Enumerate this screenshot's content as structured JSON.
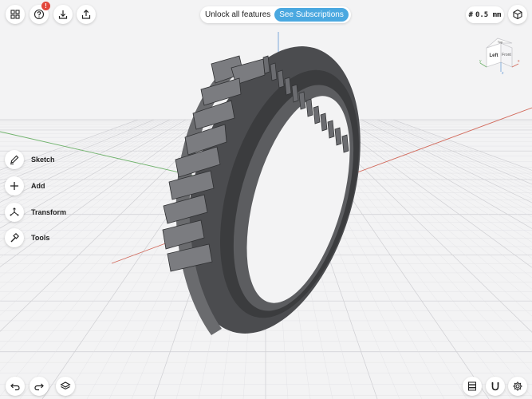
{
  "topbar": {
    "subscription_text": "Unlock all features",
    "subscription_button": "See Subscriptions",
    "grid_size": "0.5 mm",
    "help_badge": "!"
  },
  "view_cube": {
    "front_label": "Left",
    "side_label": "Front",
    "top_label": "Top",
    "axis_x": "x",
    "axis_y": "y",
    "axis_z": "z"
  },
  "tools": {
    "sketch": "Sketch",
    "add": "Add",
    "transform": "Transform",
    "tools": "Tools"
  },
  "colors": {
    "accent": "#4aa8e0",
    "badge": "#e2473b",
    "model": "#5a5b5e",
    "axis_red": "#d26a5c",
    "axis_green": "#6fb26b",
    "axis_blue": "#6fa0d8"
  }
}
